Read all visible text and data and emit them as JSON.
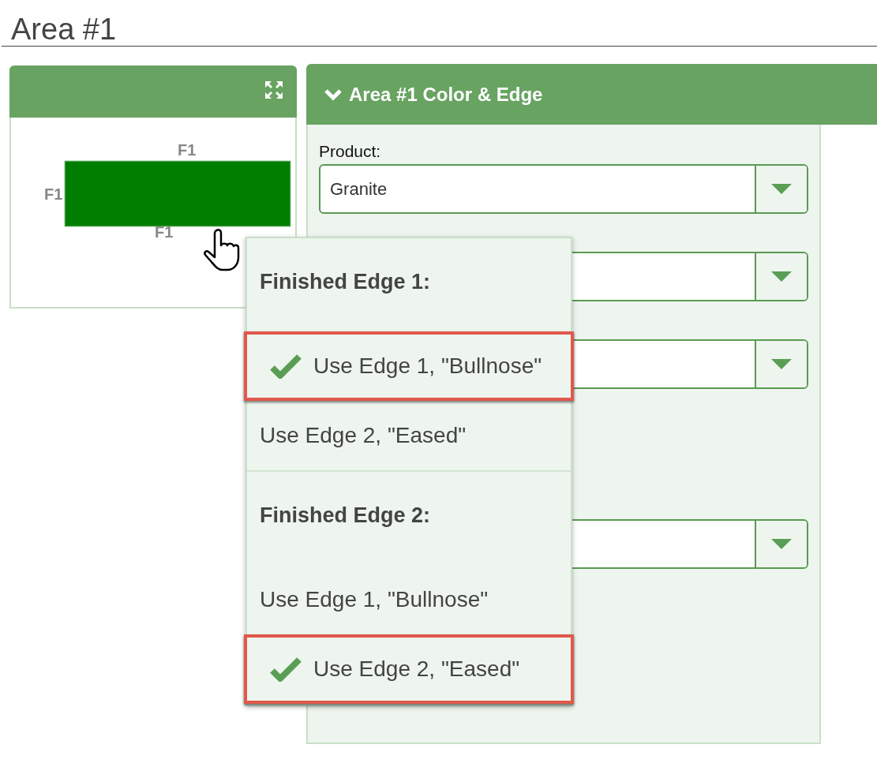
{
  "page_title": "Area #1",
  "preview_panel": {
    "edge_labels": [
      "F1",
      "F1",
      "F1"
    ]
  },
  "settings_panel": {
    "title": "Area #1 Color & Edge",
    "product_label": "Product:",
    "product_value": "Granite"
  },
  "edge_menu": {
    "groups": [
      {
        "heading": "Finished Edge 1:",
        "options": [
          {
            "label": "Use Edge 1, \"Bullnose\"",
            "selected": true
          },
          {
            "label": "Use Edge 2, \"Eased\"",
            "selected": false
          }
        ]
      },
      {
        "heading": "Finished Edge 2:",
        "options": [
          {
            "label": "Use Edge 1, \"Bullnose\"",
            "selected": false
          },
          {
            "label": "Use Edge 2, \"Eased\"",
            "selected": true
          }
        ]
      }
    ]
  }
}
